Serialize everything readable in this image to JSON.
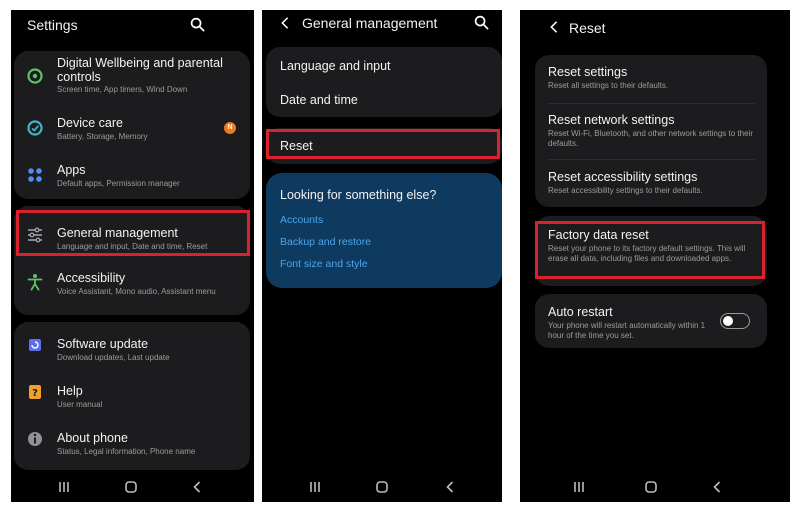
{
  "settings": {
    "title": "Settings",
    "badge": "N",
    "items": [
      {
        "title": "Digital Wellbeing and parental controls",
        "subtitle": "Screen time, App timers, Wind Down"
      },
      {
        "title": "Device care",
        "subtitle": "Battery, Storage, Memory"
      },
      {
        "title": "Apps",
        "subtitle": "Default apps, Permission manager"
      },
      {
        "title": "General management",
        "subtitle": "Language and input, Date and time, Reset"
      },
      {
        "title": "Accessibility",
        "subtitle": "Voice Assistant, Mono audio, Assistant menu"
      },
      {
        "title": "Software update",
        "subtitle": "Download updates, Last update"
      },
      {
        "title": "Help",
        "subtitle": "User manual"
      },
      {
        "title": "About phone",
        "subtitle": "Status, Legal information, Phone name"
      }
    ]
  },
  "general": {
    "title": "General management",
    "items": [
      "Language and input",
      "Date and time",
      "Reset"
    ],
    "looking": {
      "title": "Looking for something else?",
      "links": [
        "Accounts",
        "Backup and restore",
        "Font size and style"
      ]
    }
  },
  "reset": {
    "title": "Reset",
    "items": [
      {
        "title": "Reset settings",
        "subtitle": "Reset all settings to their defaults."
      },
      {
        "title": "Reset network settings",
        "subtitle": "Reset Wi-Fi, Bluetooth, and other network settings to their defaults."
      },
      {
        "title": "Reset accessibility settings",
        "subtitle": "Reset accessibility settings to their defaults."
      },
      {
        "title": "Factory data reset",
        "subtitle": "Reset your phone to its factory default settings. This will erase all data, including files and downloaded apps."
      },
      {
        "title": "Auto restart",
        "subtitle": "Your phone will restart automatically within 1 hour of the time you set."
      }
    ],
    "auto_restart_on": false
  },
  "colors": {
    "highlight": "#d8232f",
    "link": "#4aa6ee",
    "card": "#1c1c1e",
    "blue_card": "#0f3a5f"
  }
}
